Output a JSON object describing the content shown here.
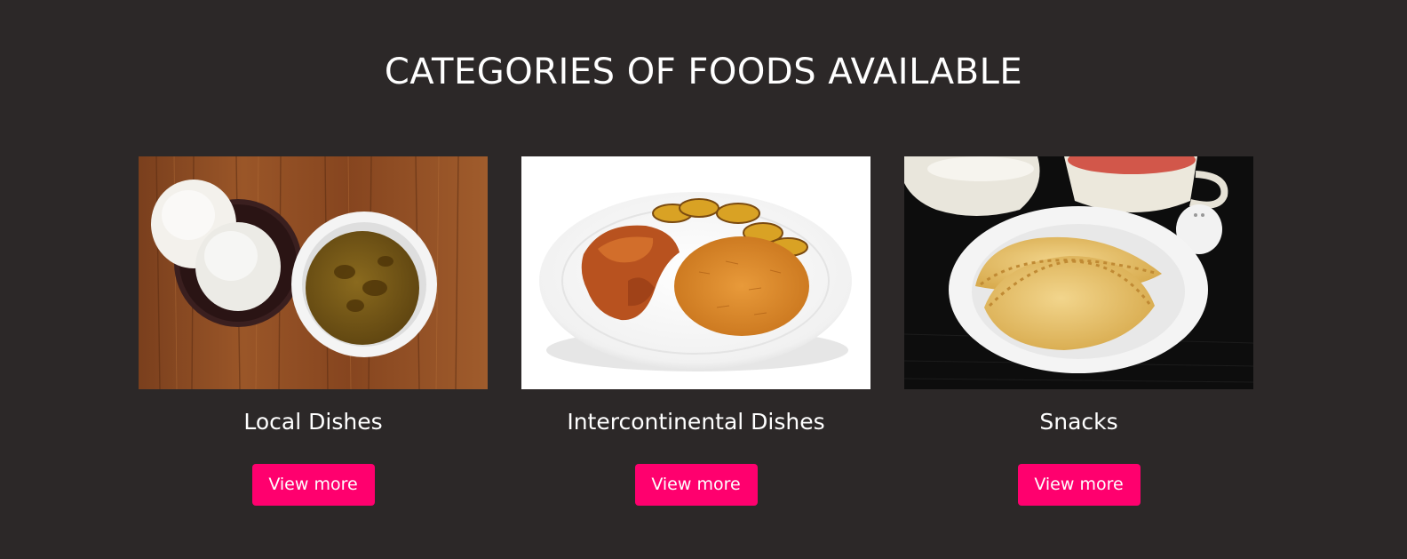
{
  "section": {
    "title": "CATEGORIES OF FOODS AVAILABLE"
  },
  "categories": [
    {
      "title": "Local Dishes",
      "button_label": "View more",
      "image": "pounded-yam-and-soup-photo"
    },
    {
      "title": "Intercontinental Dishes",
      "button_label": "View more",
      "image": "jollof-rice-chicken-plantain-photo"
    },
    {
      "title": "Snacks",
      "button_label": "View more",
      "image": "meat-pie-and-tea-photo"
    }
  ],
  "colors": {
    "background": "#2c2828",
    "accent": "#ff006e",
    "text": "#ffffff"
  }
}
